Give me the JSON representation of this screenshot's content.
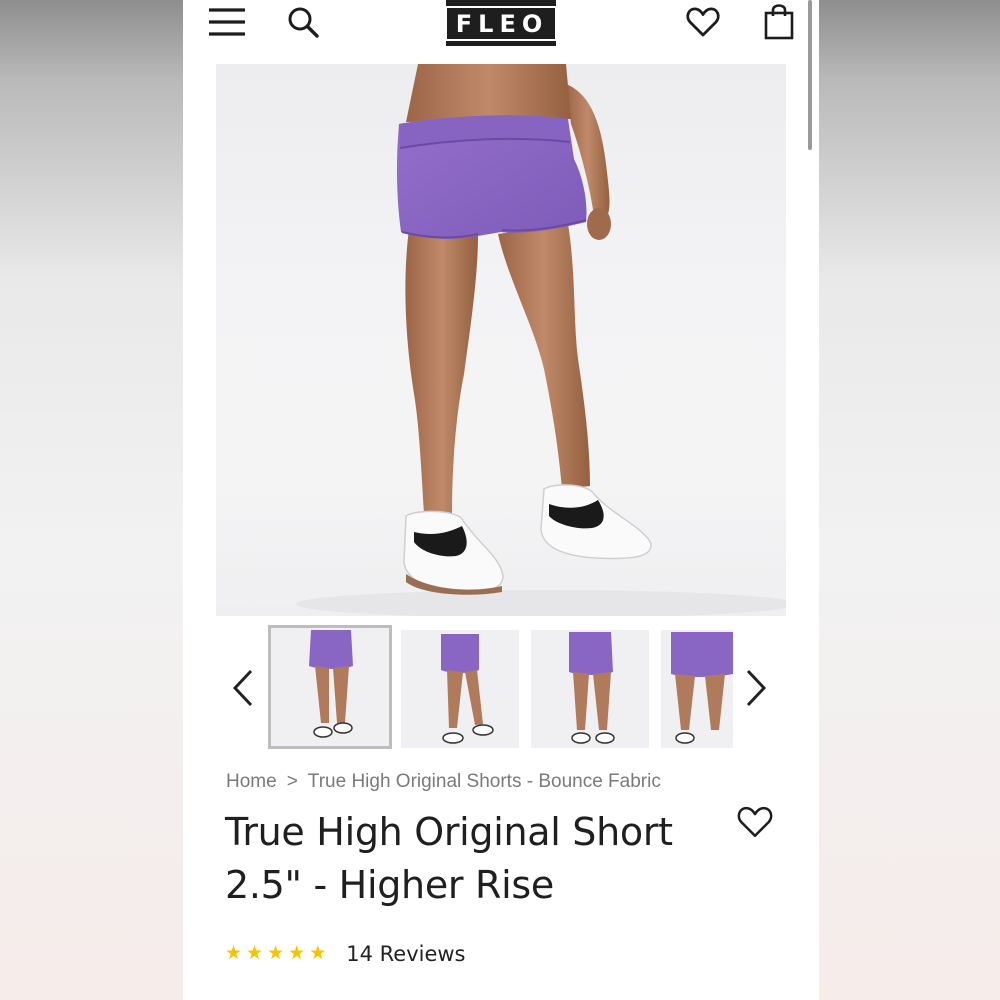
{
  "header": {
    "menu_icon": "hamburger-menu-icon",
    "search_icon": "search-icon",
    "logo_text": "FLEO",
    "wishlist_icon": "heart-outline-icon",
    "cart_icon": "shopping-bag-icon"
  },
  "gallery": {
    "main_image": "Model wearing purple heathered high-rise shorts with black and white sneakers",
    "prev_icon": "chevron-left-icon",
    "next_icon": "chevron-right-icon",
    "thumbnails": [
      {
        "view": "front",
        "selected": true
      },
      {
        "view": "side",
        "selected": false
      },
      {
        "view": "back",
        "selected": false
      },
      {
        "view": "front-close",
        "selected": false
      }
    ]
  },
  "breadcrumb": {
    "home": "Home",
    "separator": ">",
    "category": "True High Original Shorts - Bounce Fabric"
  },
  "product": {
    "title": "True High Original Short 2.5\" - Higher Rise",
    "wishlist_icon": "heart-outline-icon",
    "rating": 5,
    "rating_icon": "star-icon",
    "reviews_label": "14 Reviews"
  },
  "colors": {
    "brand_dark": "#1e1e1e",
    "short_purple": "#8a66c4",
    "star_yellow": "#f5c400",
    "text_dark": "#1f1f1f",
    "text_muted": "#7a7a7a"
  }
}
